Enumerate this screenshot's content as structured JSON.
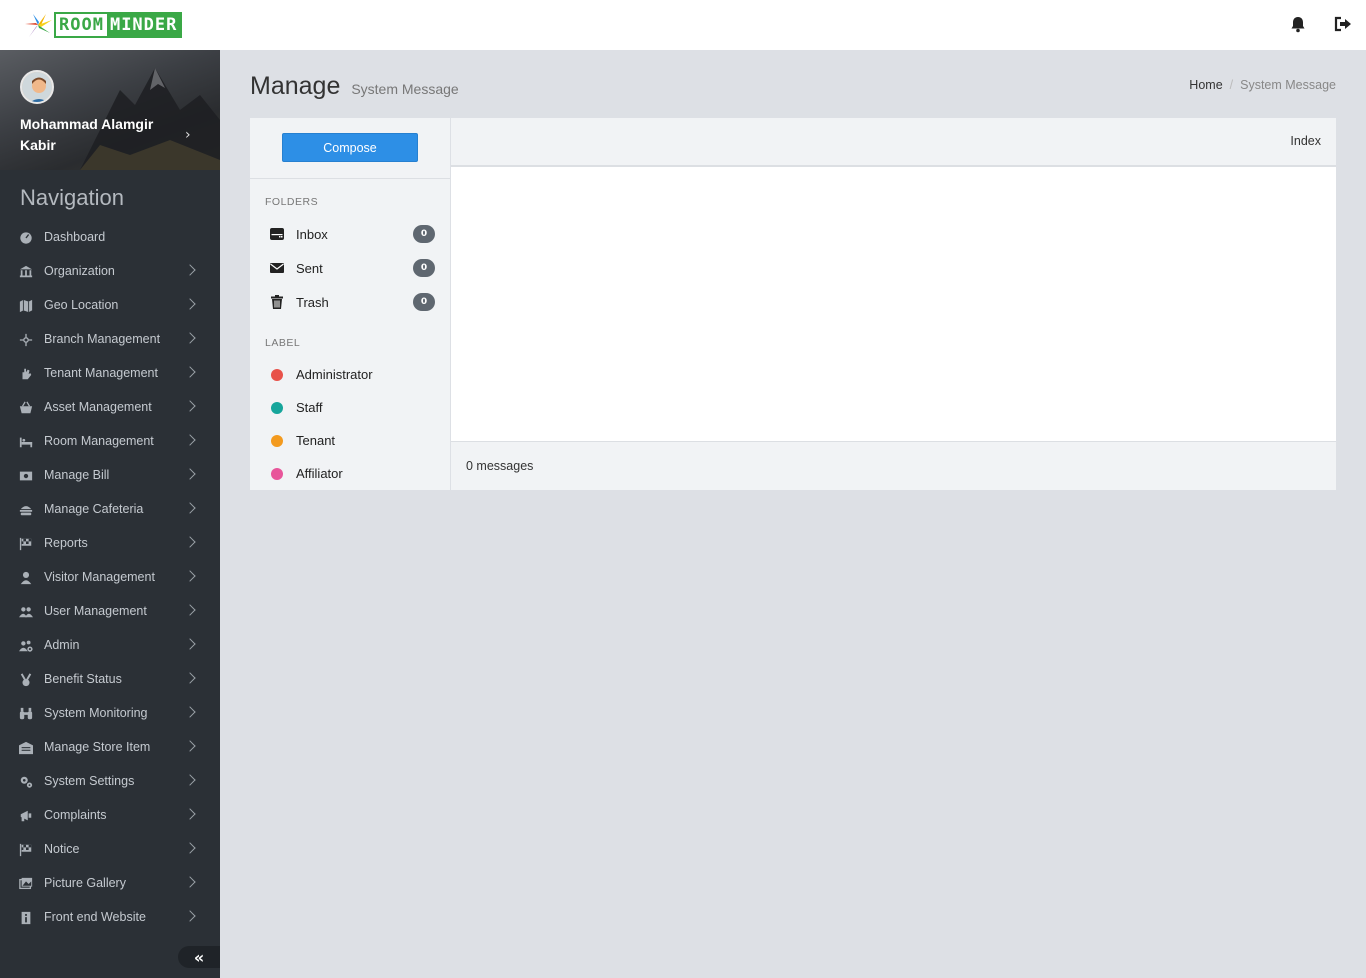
{
  "header": {
    "logo_part1": "ROOM",
    "logo_part2": "MINDER",
    "notification_icon": "bell-icon",
    "logout_icon": "sign-out-icon"
  },
  "profile": {
    "name": "Mohammad Alamgir Kabir"
  },
  "sidebar": {
    "heading": "Navigation",
    "items": [
      {
        "label": "Dashboard",
        "icon": "dashboard-icon",
        "has_children": false
      },
      {
        "label": "Organization",
        "icon": "bank-icon",
        "has_children": true
      },
      {
        "label": "Geo Location",
        "icon": "map-icon",
        "has_children": true
      },
      {
        "label": "Branch Management",
        "icon": "sitemap-icon",
        "has_children": true
      },
      {
        "label": "Tenant Management",
        "icon": "hand-icon",
        "has_children": true
      },
      {
        "label": "Asset Management",
        "icon": "basket-icon",
        "has_children": true
      },
      {
        "label": "Room Management",
        "icon": "bed-icon",
        "has_children": true
      },
      {
        "label": "Manage Bill",
        "icon": "money-icon",
        "has_children": true
      },
      {
        "label": "Manage Cafeteria",
        "icon": "burger-icon",
        "has_children": true
      },
      {
        "label": "Reports",
        "icon": "flag-checkered-icon",
        "has_children": true
      },
      {
        "label": "Visitor Management",
        "icon": "user-icon",
        "has_children": true
      },
      {
        "label": "User Management",
        "icon": "users-icon",
        "has_children": true
      },
      {
        "label": "Admin",
        "icon": "users-cog-icon",
        "has_children": true
      },
      {
        "label": "Benefit Status",
        "icon": "medal-icon",
        "has_children": true
      },
      {
        "label": "System Monitoring",
        "icon": "binoculars-icon",
        "has_children": true
      },
      {
        "label": "Manage Store Item",
        "icon": "warehouse-icon",
        "has_children": true
      },
      {
        "label": "System Settings",
        "icon": "cogs-icon",
        "has_children": true
      },
      {
        "label": "Complaints",
        "icon": "bullhorn-icon",
        "has_children": true
      },
      {
        "label": "Notice",
        "icon": "flag-checkered-icon",
        "has_children": true
      },
      {
        "label": "Picture Gallery",
        "icon": "images-icon",
        "has_children": true
      },
      {
        "label": "Front end Website",
        "icon": "info-icon",
        "has_children": true
      }
    ],
    "collapse_icon": "angle-double-left-icon"
  },
  "page": {
    "title": "Manage",
    "subtitle": "System Message",
    "breadcrumb": [
      "Home",
      "System Message"
    ]
  },
  "mailbox": {
    "compose_label": "Compose",
    "folders_heading": "FOLDERS",
    "folders": [
      {
        "label": "Inbox",
        "count": "0",
        "icon": "inbox-icon"
      },
      {
        "label": "Sent",
        "count": "0",
        "icon": "envelope-icon"
      },
      {
        "label": "Trash",
        "count": "0",
        "icon": "trash-icon"
      }
    ],
    "labels_heading": "LABEL",
    "labels": [
      {
        "label": "Administrator",
        "color": "#e8524a"
      },
      {
        "label": "Staff",
        "color": "#16a59b"
      },
      {
        "label": "Tenant",
        "color": "#f39a1e"
      },
      {
        "label": "Affiliator",
        "color": "#e8559a"
      }
    ],
    "panel_title": "Index",
    "footer_text": "0 messages"
  }
}
